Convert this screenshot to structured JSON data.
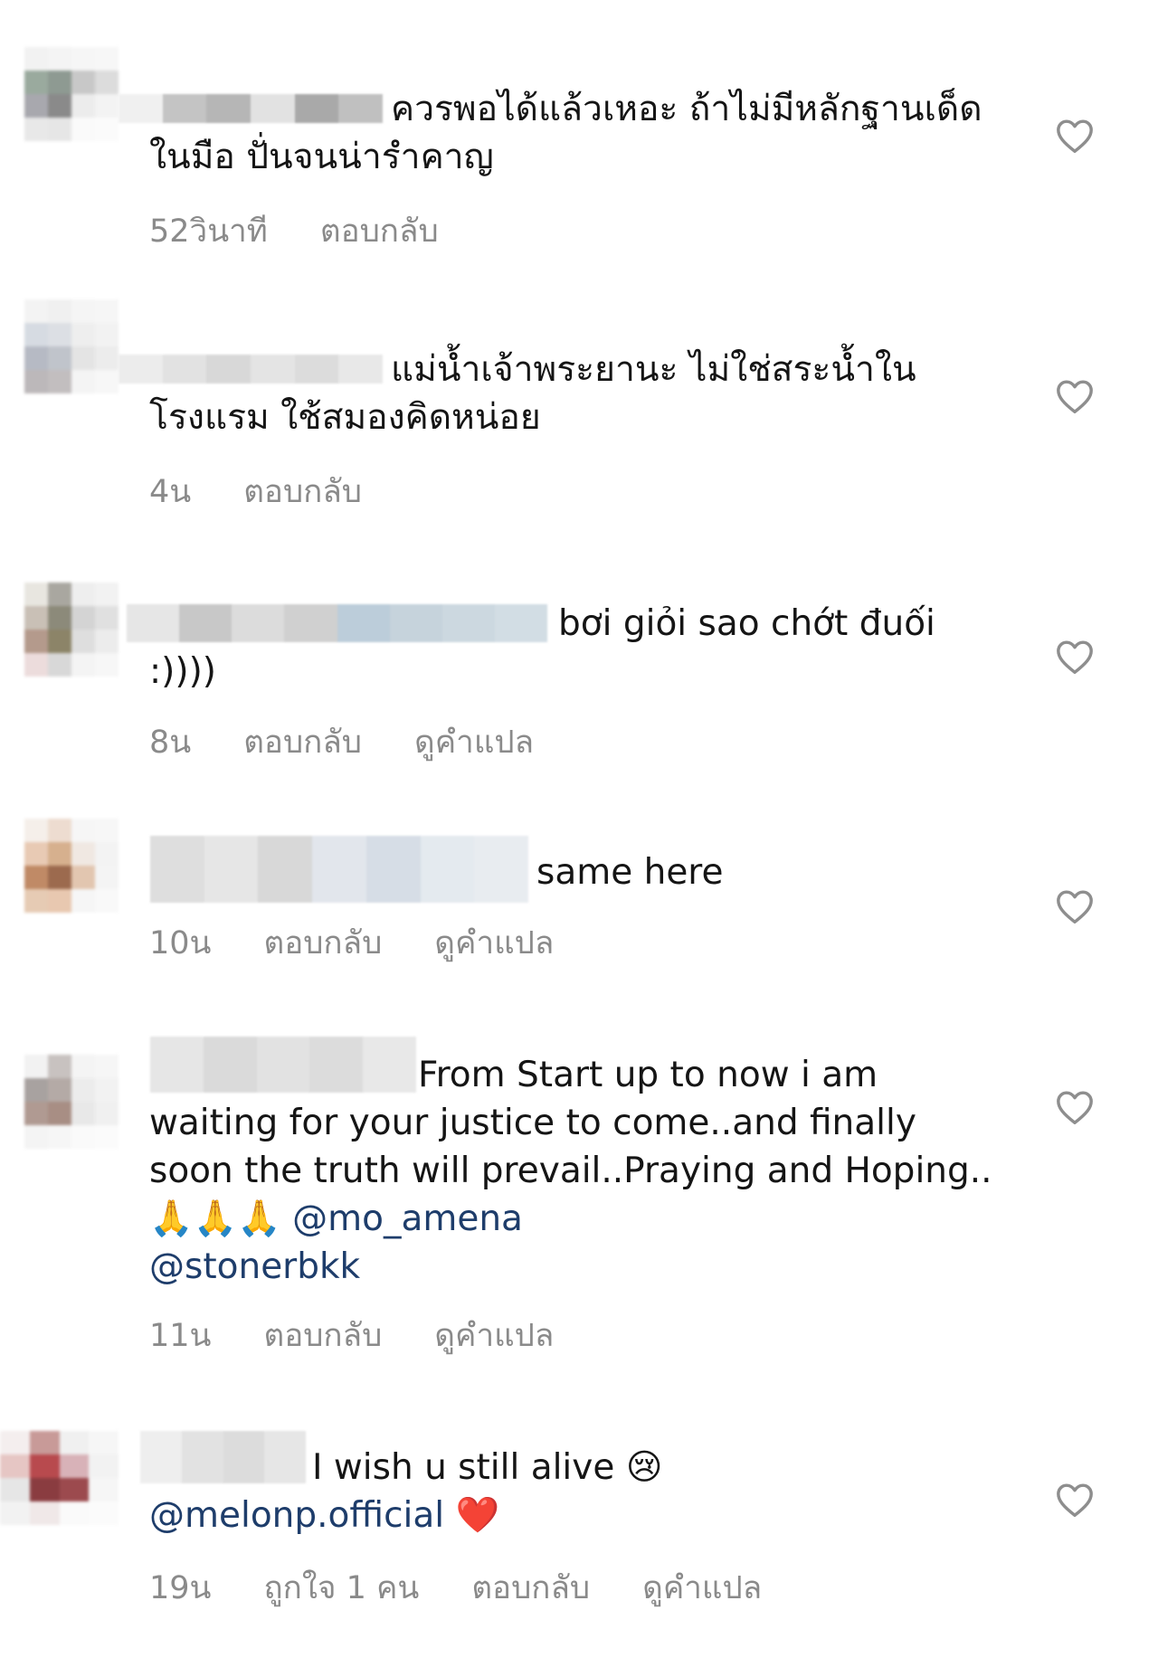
{
  "comments": [
    {
      "text": "ควรพอได้แล้วเหอะ ถ้าไม่มีหลักฐานเด็ดในมือ ปั่นจนน่ารำคาญ",
      "time": "52วินาที",
      "reply": "ตอบกลับ"
    },
    {
      "text": "แม่น้ำเจ้าพระยานะ ไม่ใช่สระน้ำในโรงแรม ใช้สมองคิดหน่อย",
      "time": "4น",
      "reply": "ตอบกลับ"
    },
    {
      "text": "bơi giỏi sao chớt đuối :))))",
      "time": "8น",
      "reply": "ตอบกลับ",
      "translate": "ดูคำแปล"
    },
    {
      "text": "same here",
      "time": "10น",
      "reply": "ตอบกลับ",
      "translate": "ดูคำแปล"
    },
    {
      "text": "From Start up to now i am waiting for your justice to come..and finally soon the truth will prevail..Praying and Hoping.. 🙏🙏🙏",
      "mention1": "@mo_amena",
      "mention2": "@stonerbkk",
      "time": "11น",
      "reply": "ตอบกลับ",
      "translate": "ดูคำแปล"
    },
    {
      "text": "I wish u still alive 😢",
      "mention1": "@melonp.official",
      "heart_emoji": "❤️",
      "time": "19น",
      "likes": "ถูกใจ 1 คน",
      "reply": "ตอบกลับ",
      "translate": "ดูคำแปล"
    }
  ],
  "colors": {
    "meta": "#8a8a8a",
    "mention": "#1e3d6b",
    "heart_stroke": "#8e8e8e"
  },
  "icons": {
    "like": "heart-outline-icon"
  }
}
